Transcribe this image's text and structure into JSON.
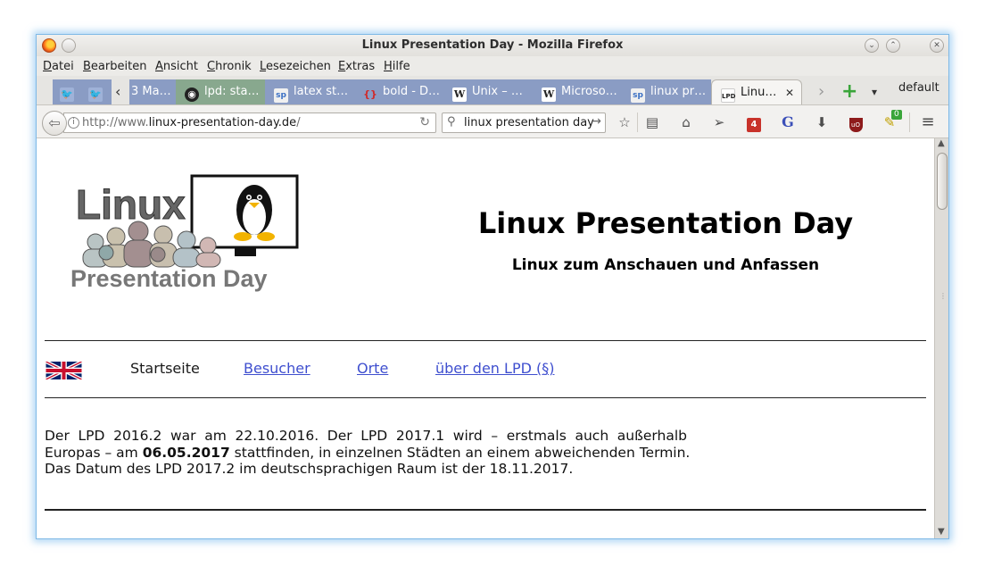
{
  "window": {
    "title": "Linux Presentation Day - Mozilla Firefox",
    "controls": {
      "minimize_glyph": "⌄",
      "maximize_glyph": "⌃",
      "close_glyph": "✕"
    }
  },
  "menu": [
    {
      "acc": "D",
      "rest": "atei"
    },
    {
      "acc": "B",
      "rest": "earbeiten"
    },
    {
      "acc": "A",
      "rest": "nsicht"
    },
    {
      "acc": "C",
      "rest": "hronik"
    },
    {
      "acc": "L",
      "rest": "esezeichen"
    },
    {
      "acc": "E",
      "rest": "xtras"
    },
    {
      "acc": "H",
      "rest": "ilfe"
    }
  ],
  "tabs": {
    "overflow_left": "‹",
    "items": [
      {
        "label": "3 Ma…",
        "icon": "twitter-icon",
        "color": "#8a9cc4"
      },
      {
        "label": "lpd: sta…",
        "icon": "github-icon",
        "color": "#88a88e"
      },
      {
        "label": "latex st…",
        "icon": "sp-icon",
        "color": "#8a9cc4"
      },
      {
        "label": "bold - D…",
        "icon": "braces-icon",
        "color": "#8a9cc4"
      },
      {
        "label": "Unix – …",
        "icon": "wikipedia-icon",
        "color": "#8a9cc4"
      },
      {
        "label": "Microso…",
        "icon": "wikipedia-icon",
        "color": "#8a9cc4"
      },
      {
        "label": "linux pr…",
        "icon": "sp-icon",
        "color": "#8a9cc4"
      }
    ],
    "active": {
      "label": "Linu…",
      "fav_text": "LPD",
      "close": "✕"
    },
    "overflow_right": "›",
    "new_tab": "+",
    "list_all": "▾",
    "profile": "default"
  },
  "nav": {
    "url_prefix": "http://www.",
    "url_domain": "linux-presentation-day.de",
    "url_suffix": "/",
    "search_text": "linux presentation day",
    "badge_red": "4",
    "addon_badge": "0"
  },
  "page": {
    "logo_word": "Linux",
    "logo_sub": "Presentation Day",
    "title": "Linux Presentation Day",
    "subtitle": "Linux zum Anschauen und Anfassen",
    "navigation": {
      "current": "Startseite",
      "links": [
        "Besucher",
        "Orte",
        "über den LPD (§)"
      ]
    },
    "paragraph": {
      "line1": "Der LPD 2016.2 war am 22.10.2016. Der LPD 2017.1 wird – erstmals auch außerhalb",
      "line2_a": "Europas – am ",
      "line2_b": "06.05.2017",
      "line2_c": " stattfinden, in einzelnen Städten an einem abweichenden Termin.",
      "line3": "Das Datum des LPD 2017.2 im deutschsprachigen Raum ist der 18.11.2017."
    }
  }
}
